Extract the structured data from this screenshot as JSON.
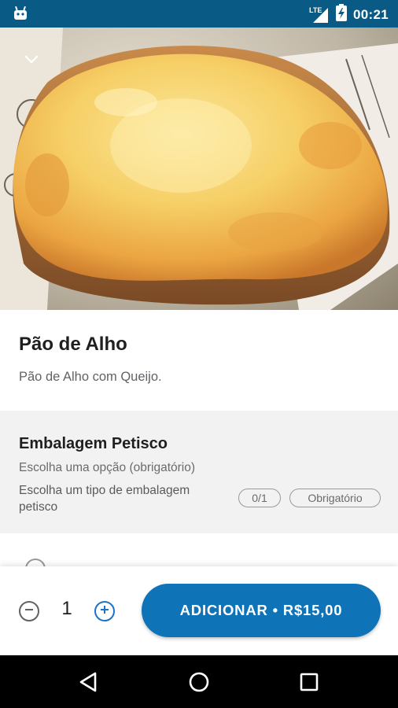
{
  "status_bar": {
    "time": "00:21",
    "network_label": "LTE",
    "app_icon": "android-icon",
    "signal_icon": "cell-signal-icon",
    "battery_icon": "battery-charging-icon"
  },
  "hero": {
    "image": "garlic-bread-cheese-photo",
    "back_icon": "chevron-down-icon"
  },
  "product": {
    "title": "Pão de Alho",
    "description": "Pão de Alho com Queijo."
  },
  "option_group": {
    "title": "Embalagem Petisco",
    "subtitle": "Escolha uma opção (obrigatório)",
    "hint": "Escolha um tipo de embalagem petisco",
    "count_badge": "0/1",
    "required_badge": "Obrigatório"
  },
  "quantity": {
    "value": "1",
    "minus_icon": "minus-circle-icon",
    "plus_icon": "plus-circle-icon"
  },
  "add_button": {
    "label": "ADICIONAR • R$15,00"
  },
  "nav_bar": {
    "back_icon": "nav-back-icon",
    "home_icon": "nav-home-icon",
    "recent_icon": "nav-recents-icon"
  },
  "colors": {
    "status_bar": "#0a5a86",
    "accent": "#0f73b8",
    "group_background": "#f2f2f2"
  }
}
